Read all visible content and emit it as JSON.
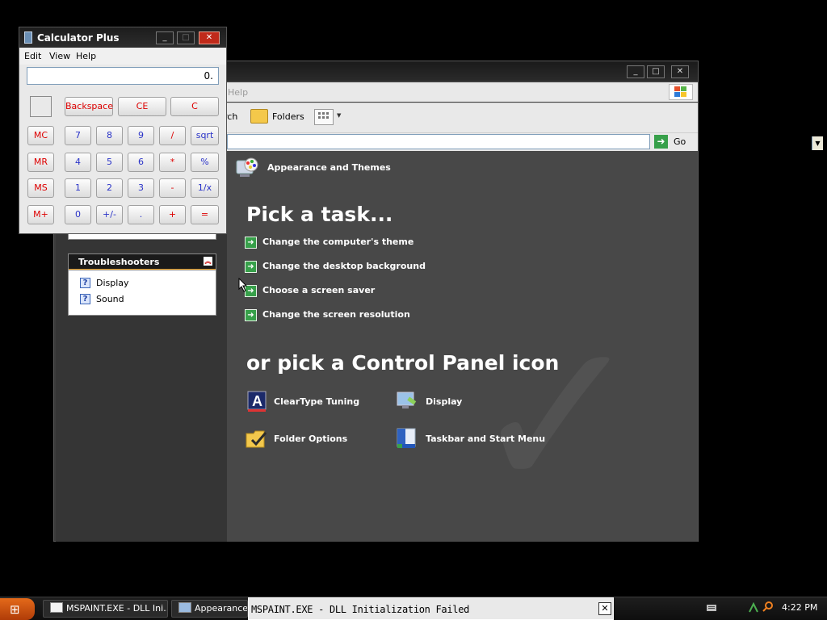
{
  "control_panel": {
    "window_buttons": {
      "minimize": "_",
      "maximize": "□",
      "close": "✕"
    },
    "menubar": {
      "help": "Help"
    },
    "toolbar": {
      "search_label": "rch",
      "folders_label": "Folders"
    },
    "addressbar": {
      "go_label": "Go"
    },
    "left_pane": {
      "troubleshooters": {
        "title": "Troubleshooters",
        "items": [
          {
            "label": "Display",
            "icon": "help-icon"
          },
          {
            "label": "Sound",
            "icon": "help-icon"
          }
        ]
      }
    },
    "main": {
      "category_title": "Appearance and Themes",
      "pick_task_heading": "Pick a task...",
      "tasks": [
        {
          "label": "Change the computer's theme"
        },
        {
          "label": "Change the desktop background"
        },
        {
          "label": "Choose a screen saver"
        },
        {
          "label": "Change the screen resolution"
        }
      ],
      "pick_icon_heading": "or pick a Control Panel icon",
      "icons": [
        {
          "label": "ClearType Tuning",
          "icon": "cleartype-icon"
        },
        {
          "label": "Display",
          "icon": "display-icon"
        },
        {
          "label": "Folder Options",
          "icon": "folder-options-icon"
        },
        {
          "label": "Taskbar and Start Menu",
          "icon": "taskbar-start-menu-icon"
        }
      ]
    }
  },
  "calculator": {
    "title": "Calculator Plus",
    "window_buttons": {
      "minimize": "_",
      "maximize": "□",
      "close": "✕"
    },
    "menu": [
      "Edit",
      "View",
      "Help"
    ],
    "display_value": "0.",
    "keys": {
      "backspace": "Backspace",
      "ce": "CE",
      "c": "C",
      "mc": "MC",
      "mr": "MR",
      "ms": "MS",
      "mplus": "M+",
      "k7": "7",
      "k8": "8",
      "k9": "9",
      "div": "/",
      "sqrt": "sqrt",
      "k4": "4",
      "k5": "5",
      "k6": "6",
      "mul": "*",
      "pct": "%",
      "k1": "1",
      "k2": "2",
      "k3": "3",
      "sub": "-",
      "recip": "1/x",
      "k0": "0",
      "sign": "+/-",
      "dot": ".",
      "add": "+",
      "eq": "="
    }
  },
  "taskbar": {
    "start_label": "⊞",
    "buttons": [
      {
        "label": "MSPAINT.EXE - DLL Ini..."
      },
      {
        "label": "Appearance a"
      }
    ],
    "notification": {
      "text": "MSPAINT.EXE - DLL Initialization Failed",
      "close": "✕"
    },
    "clock": "4:22 PM"
  },
  "colors": {
    "task_green": "#37a04a",
    "calc_red": "#dd0000",
    "calc_blue": "#2a33c8",
    "start_orange": "#d4561a"
  }
}
